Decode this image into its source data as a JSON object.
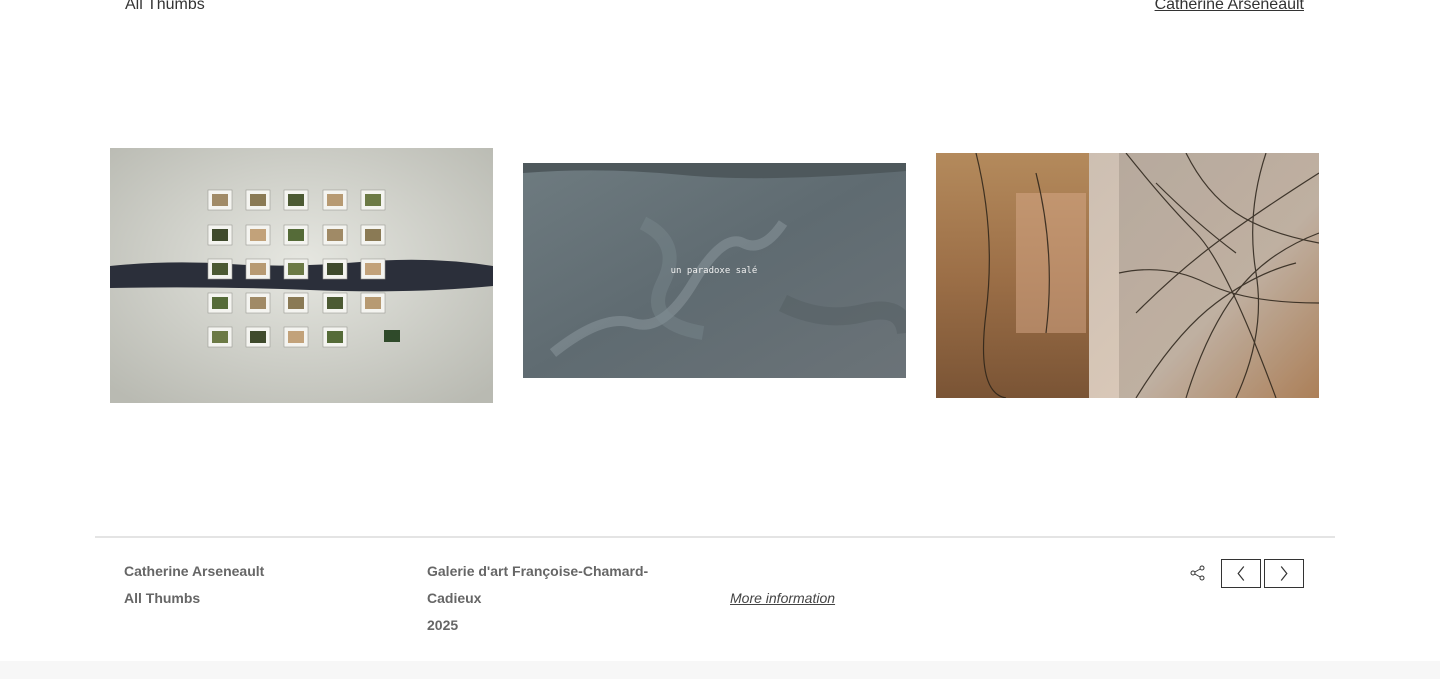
{
  "header": {
    "album_link": "All Thumbs",
    "artist_link": "Catherine Arseneault"
  },
  "thumbnails": [
    {
      "name": "installation-photo",
      "caption": ""
    },
    {
      "name": "video-still",
      "caption": "un paradoxe salé"
    },
    {
      "name": "branches-photo",
      "caption": ""
    }
  ],
  "footer": {
    "artist": "Catherine Arseneault",
    "album": "All Thumbs",
    "gallery": "Galerie d'art Françoise-Chamard-Cadieux",
    "year": "2025",
    "more_info": "More information"
  },
  "icons": {
    "share": "share-icon",
    "prev": "chevron-left-icon",
    "next": "chevron-right-icon"
  }
}
